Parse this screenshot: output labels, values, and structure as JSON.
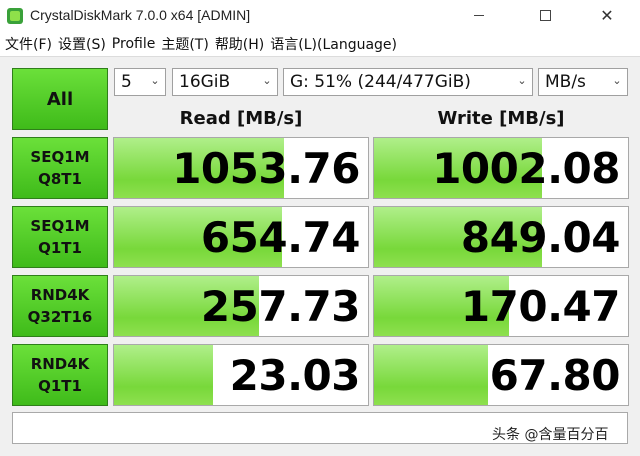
{
  "window": {
    "title": "CrystalDiskMark 7.0.0 x64 [ADMIN]",
    "min_symbol": "",
    "max_symbol": "",
    "close_symbol": "✕"
  },
  "menu": [
    "文件(F)",
    "设置(S)",
    "Profile",
    "主题(T)",
    "帮助(H)",
    "语言(L)(Language)"
  ],
  "toolbar": {
    "all_label": "All",
    "count": "5",
    "size": "16GiB",
    "drive": "G: 51% (244/477GiB)",
    "unit": "MB/s"
  },
  "headers": {
    "read": "Read [MB/s]",
    "write": "Write [MB/s]"
  },
  "tests": [
    {
      "line1": "SEQ1M",
      "line2": "Q8T1",
      "read": "1053.76",
      "write": "1002.08",
      "read_fill": 0.67,
      "write_fill": 0.66
    },
    {
      "line1": "SEQ1M",
      "line2": "Q1T1",
      "read": "654.74",
      "write": "849.04",
      "read_fill": 0.66,
      "write_fill": 0.66
    },
    {
      "line1": "RND4K",
      "line2": "Q32T16",
      "read": "257.73",
      "write": "170.47",
      "read_fill": 0.57,
      "write_fill": 0.53
    },
    {
      "line1": "RND4K",
      "line2": "Q1T1",
      "read": "23.03",
      "write": "67.80",
      "read_fill": 0.39,
      "write_fill": 0.45
    }
  ],
  "comment": "",
  "watermark": "头条 @含量百分百",
  "colors": {
    "accent_green": "#3fbb1a",
    "bar_green": "#78d83a"
  }
}
